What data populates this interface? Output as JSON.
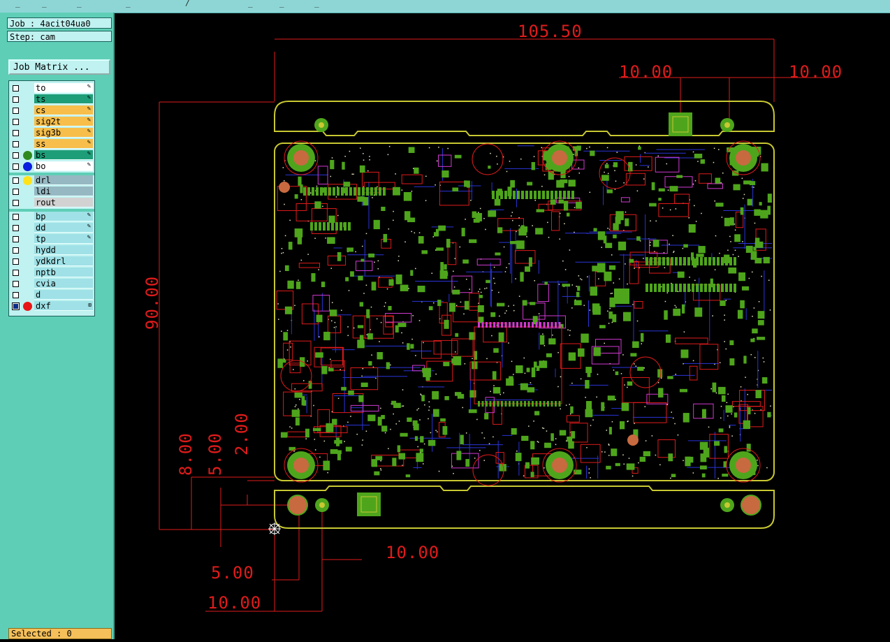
{
  "header": {
    "job_label": "Job : 4acit04ua0",
    "step_label": "Step: cam",
    "job_matrix_button": "Job Matrix ..."
  },
  "layers": {
    "board": [
      {
        "name": "to",
        "bg": "#ffffff",
        "dot": null,
        "checked": false,
        "icon": "pen-icon"
      },
      {
        "name": "ts",
        "bg": "#1e9e78",
        "dot": null,
        "checked": false,
        "icon": "pen-icon"
      },
      {
        "name": "cs",
        "bg": "#f7be4b",
        "dot": null,
        "checked": false,
        "icon": "pen-icon"
      },
      {
        "name": "sig2t",
        "bg": "#f7be4b",
        "dot": null,
        "checked": false,
        "icon": "pen-icon"
      },
      {
        "name": "sig3b",
        "bg": "#f7be4b",
        "dot": null,
        "checked": false,
        "icon": "pen-icon"
      },
      {
        "name": "ss",
        "bg": "#f7be4b",
        "dot": null,
        "checked": false,
        "icon": "pen-icon"
      },
      {
        "name": "bs",
        "bg": "#1e9e78",
        "dot": "#2f8a1e",
        "checked": false,
        "icon": "pen-icon"
      },
      {
        "name": "bo",
        "bg": "#ffffff",
        "dot": "#0a1ee0",
        "checked": false,
        "icon": "pen-icon"
      }
    ],
    "drill": [
      {
        "name": "drl",
        "bg": "#96b8c2",
        "dot": "#ffe21a",
        "checked": false
      },
      {
        "name": "ldi",
        "bg": "#96b8c2",
        "dot": null,
        "checked": false
      },
      {
        "name": "rout",
        "bg": "#d2d2d2",
        "dot": null,
        "checked": false
      }
    ],
    "misc": [
      {
        "name": "bp",
        "bg": "#9fe1e6",
        "dot": null,
        "checked": false,
        "icon": "pen-icon"
      },
      {
        "name": "dd",
        "bg": "#9fe1e6",
        "dot": null,
        "checked": false,
        "icon": "pen-icon"
      },
      {
        "name": "tp",
        "bg": "#9fe1e6",
        "dot": null,
        "checked": false,
        "icon": "pen-icon"
      },
      {
        "name": "hydd",
        "bg": "#9fe1e6",
        "dot": null,
        "checked": false
      },
      {
        "name": "ydkdrl",
        "bg": "#9fe1e6",
        "dot": null,
        "checked": false
      },
      {
        "name": "nptb",
        "bg": "#9fe1e6",
        "dot": null,
        "checked": false
      },
      {
        "name": "cvia",
        "bg": "#9fe1e6",
        "dot": null,
        "checked": false
      },
      {
        "name": "d",
        "bg": "#9fe1e6",
        "dot": null,
        "checked": false
      },
      {
        "name": "dxf",
        "bg": "#9fe1e6",
        "dot": "#e81616",
        "checked": true,
        "icon": "scroll-icon"
      }
    ]
  },
  "status": {
    "selected": "Selected : 0"
  },
  "dimensions": {
    "width": "105.50",
    "rail_top_left": "10.00",
    "rail_top_right": "10.00",
    "height": "90.00",
    "left_8": "8.00",
    "left_5": "5.00",
    "left_2": "2.00",
    "bottom_10_a": "10.00",
    "bottom_5": "5.00",
    "bottom_10_b": "10.00"
  },
  "colors": {
    "outline": "#c8c832",
    "dimension": "#e01b1b",
    "pad_green": "#4ea51c",
    "trace_red": "#e01b1b",
    "trace_blue": "#2a34d8",
    "trace_magenta": "#d23ad2"
  }
}
